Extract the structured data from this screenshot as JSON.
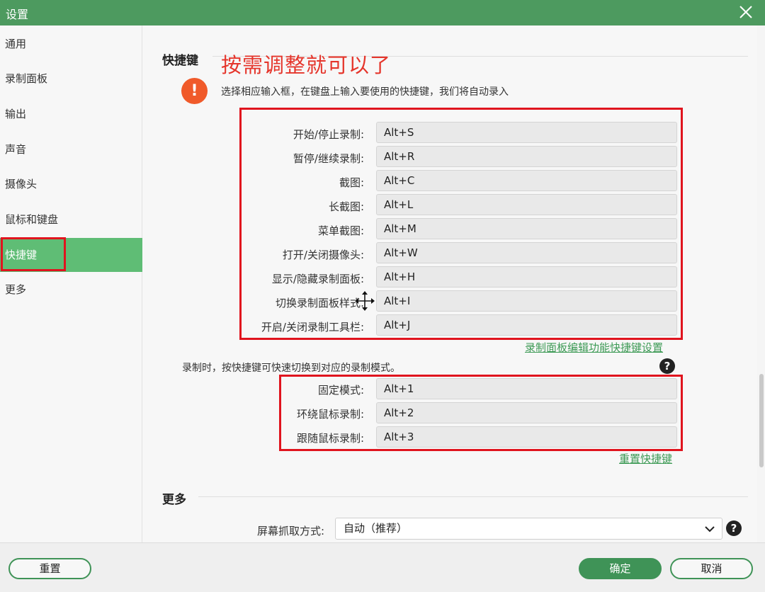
{
  "window": {
    "title": "设置"
  },
  "sidebar": {
    "items": [
      {
        "label": "通用"
      },
      {
        "label": "录制面板"
      },
      {
        "label": "输出"
      },
      {
        "label": "声音"
      },
      {
        "label": "摄像头"
      },
      {
        "label": "鼠标和键盘"
      },
      {
        "label": "快捷键",
        "active": true
      },
      {
        "label": "更多"
      }
    ]
  },
  "shortcuts_section": {
    "title": "快捷键",
    "annotation": "按需调整就可以了",
    "hint": "选择相应输入框，在键盘上输入要使用的快捷键，我们将自动录入",
    "items": [
      {
        "label": "开始/停止录制:",
        "value": "Alt+S"
      },
      {
        "label": "暂停/继续录制:",
        "value": "Alt+R"
      },
      {
        "label": "截图:",
        "value": "Alt+C"
      },
      {
        "label": "长截图:",
        "value": "Alt+L"
      },
      {
        "label": "菜单截图:",
        "value": "Alt+M"
      },
      {
        "label": "打开/关闭摄像头:",
        "value": "Alt+W"
      },
      {
        "label": "显示/隐藏录制面板:",
        "value": "Alt+H"
      },
      {
        "label": "切换录制面板样式:",
        "value": "Alt+I"
      },
      {
        "label": "开启/关闭录制工具栏:",
        "value": "Alt+J"
      }
    ],
    "edit_link": "录制面板编辑功能快捷键设置",
    "mode_note": "录制时，按快捷键可快速切换到对应的录制模式。",
    "mode_items": [
      {
        "label": "固定模式:",
        "value": "Alt+1"
      },
      {
        "label": "环绕鼠标录制:",
        "value": "Alt+2"
      },
      {
        "label": "跟随鼠标录制:",
        "value": "Alt+3"
      }
    ],
    "reset_link": "重置快捷键"
  },
  "more_section": {
    "title": "更多",
    "capture_label": "屏幕抓取方式:",
    "capture_value": "自动（推荐）"
  },
  "footer": {
    "reset": "重置",
    "ok": "确定",
    "cancel": "取消"
  },
  "colors": {
    "titlebar": "#4d9a5f",
    "accent": "#3f9357",
    "active_nav": "#5fbd75",
    "annotation_red": "#e0141e",
    "warning": "#f05a2a"
  },
  "icons": [
    "close-icon",
    "warning-icon",
    "help-icon",
    "chevron-down-icon",
    "move-cursor-icon"
  ]
}
